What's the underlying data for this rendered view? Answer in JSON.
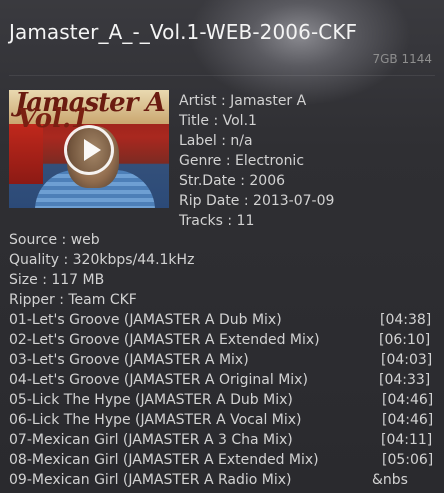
{
  "header": {
    "title": "Jamaster_A_-_Vol.1-WEB-2006-CKF",
    "meta": "7GB 1144"
  },
  "cover": {
    "logo_top": "Jamaster A",
    "logo_sub": "Vol.1"
  },
  "details": {
    "artist": "Artist :  Jamaster A",
    "title": "Title : Vol.1",
    "label": "Label :  n/a",
    "genre": "Genre : Electronic",
    "str_date": "Str.Date :  2006",
    "rip_date": "Rip Date : 2013-07-09",
    "tracks": "Tracks :  11"
  },
  "release": {
    "source": "Source :  web",
    "quality": "Quality : 320kbps/44.1kHz",
    "size": "Size :  117 MB",
    "ripper": "Ripper :  Team CKF"
  },
  "tracklist": [
    {
      "name": "01-Let's Groove (JAMASTER A Dub Mix)",
      "time": "[04:38]"
    },
    {
      "name": "02-Let's Groove (JAMASTER A Extended Mix)",
      "time": "[06:10]"
    },
    {
      "name": "03-Let's Groove (JAMASTER A Mix)",
      "time": "[04:03]"
    },
    {
      "name": "04-Let's Groove (JAMASTER A Original Mix)",
      "time": "[04:33]"
    },
    {
      "name": "05-Lick The Hype (JAMASTER A Dub Mix)",
      "time": "[04:46]"
    },
    {
      "name": "06-Lick The Hype (JAMASTER A Vocal Mix)",
      "time": "[04:46]"
    },
    {
      "name": "07-Mexican Girl (JAMASTER A 3 Cha Mix)",
      "time": "[04:11]"
    },
    {
      "name": "08-Mexican Girl (JAMASTER A Extended Mix)",
      "time": "[05:06]"
    },
    {
      "name": "09-Mexican Girl (JAMASTER A Radio Mix)",
      "time": "&nbs"
    }
  ],
  "icons": {
    "play": "play-icon"
  }
}
